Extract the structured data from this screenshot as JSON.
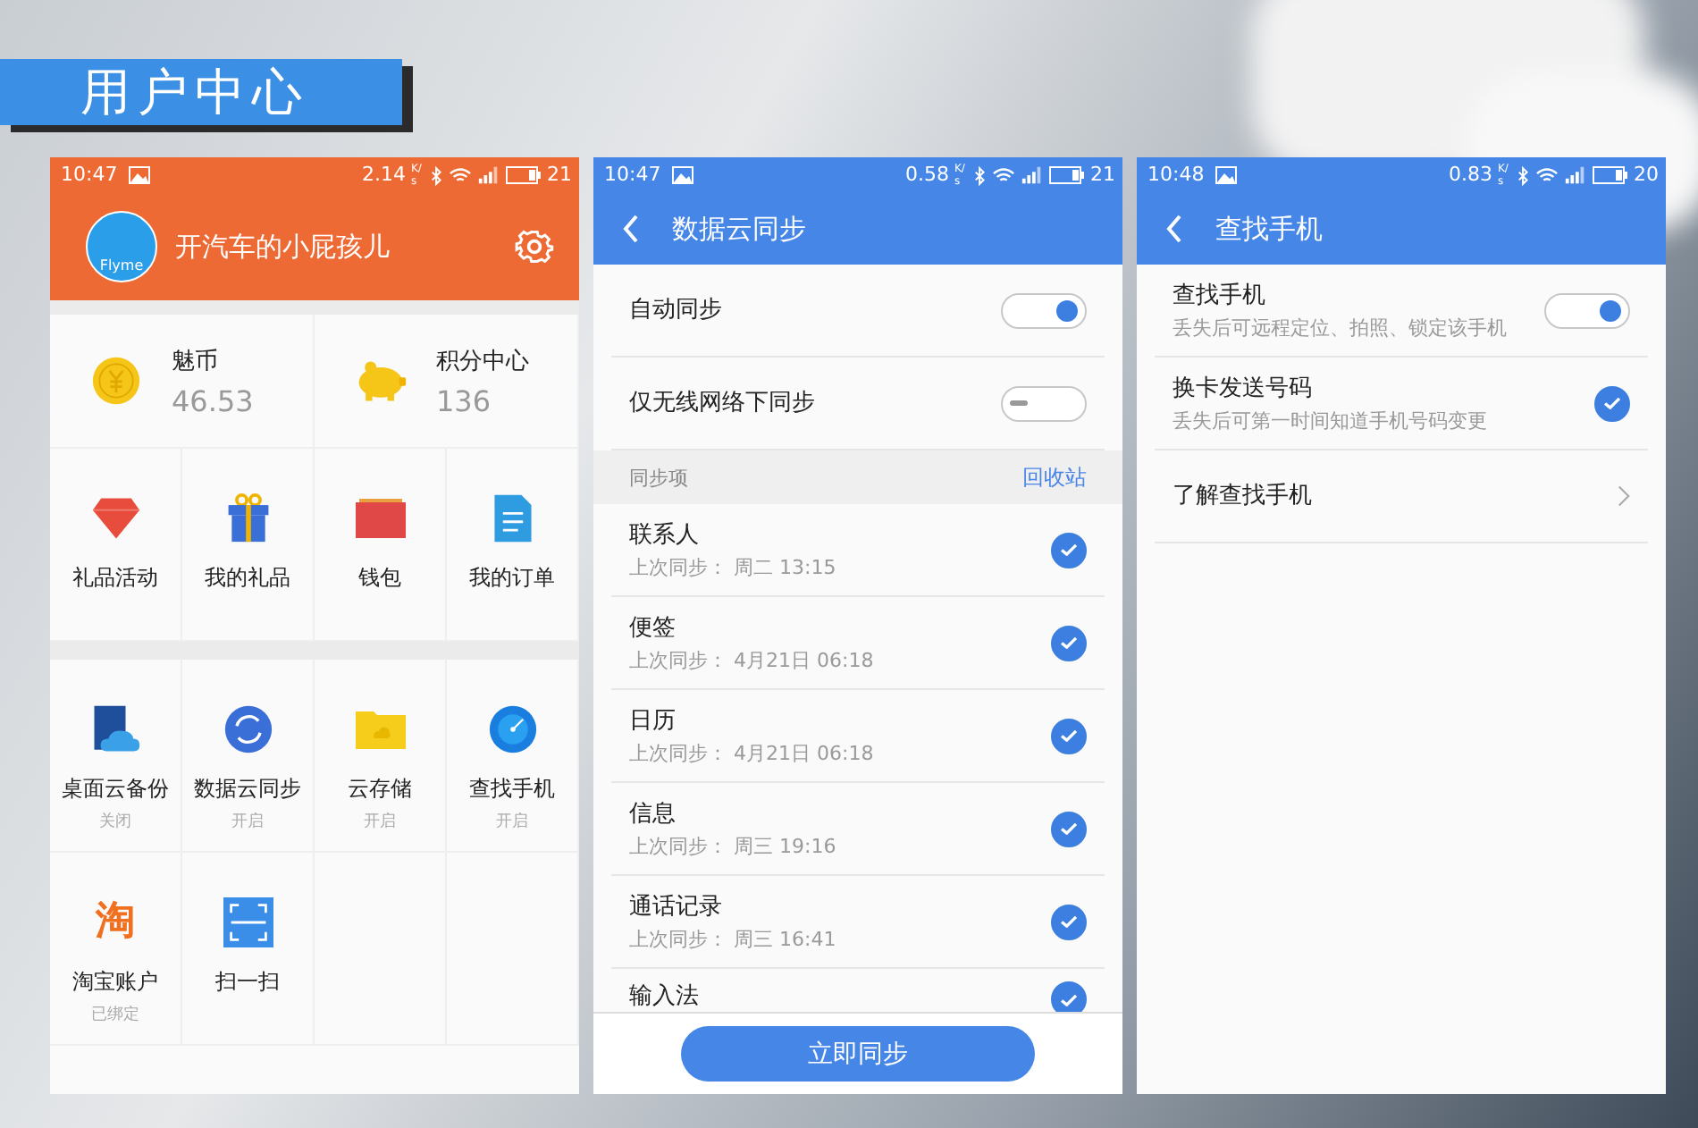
{
  "banner": {
    "title": "用户中心"
  },
  "account_screen": {
    "status_bar": {
      "time": "10:47",
      "rate": "2.14",
      "rate_unit": "K/s",
      "battery": "21"
    },
    "user": {
      "name": "开汽车的小屁孩儿",
      "avatar_text": "Flyme"
    },
    "wallet": [
      {
        "label": "魅币",
        "value": "46.53"
      },
      {
        "label": "积分中心",
        "value": "136"
      }
    ],
    "shortcuts": [
      {
        "label": "礼品活动"
      },
      {
        "label": "我的礼品"
      },
      {
        "label": "钱包"
      },
      {
        "label": "我的订单"
      }
    ],
    "services": [
      {
        "label": "桌面云备份",
        "status": "关闭"
      },
      {
        "label": "数据云同步",
        "status": "开启"
      },
      {
        "label": "云存储",
        "status": "开启"
      },
      {
        "label": "查找手机",
        "status": "开启"
      },
      {
        "label": "淘宝账户",
        "status": "已绑定",
        "icon_glyph": "淘"
      },
      {
        "label": "扫一扫"
      }
    ]
  },
  "sync_screen": {
    "status_bar": {
      "time": "10:47",
      "rate": "0.58",
      "rate_unit": "K/s",
      "battery": "21"
    },
    "title": "数据云同步",
    "settings": [
      {
        "label": "自动同步",
        "on": true
      },
      {
        "label": "仅无线网络下同步",
        "on": false
      }
    ],
    "section": {
      "label": "同步项",
      "link": "回收站"
    },
    "items": [
      {
        "name": "联系人",
        "last_sync": "上次同步： 周二 13:15",
        "checked": true
      },
      {
        "name": "便签",
        "last_sync": "上次同步： 4月21日 06:18",
        "checked": true
      },
      {
        "name": "日历",
        "last_sync": "上次同步： 4月21日 06:18",
        "checked": true
      },
      {
        "name": "信息",
        "last_sync": "上次同步： 周三 19:16",
        "checked": true
      },
      {
        "name": "通话记录",
        "last_sync": "上次同步： 周三 16:41",
        "checked": true
      },
      {
        "name": "输入法",
        "checked": true
      }
    ],
    "button": "立即同步"
  },
  "find_phone_screen": {
    "status_bar": {
      "time": "10:48",
      "rate": "0.83",
      "rate_unit": "K/s",
      "battery": "20"
    },
    "title": "查找手机",
    "rows": [
      {
        "kind": "toggle",
        "title": "查找手机",
        "subtitle": "丢失后可远程定位、拍照、锁定该手机",
        "on": true
      },
      {
        "kind": "check",
        "title": "换卡发送号码",
        "subtitle": "丢失后可第一时间知道手机号码变更",
        "checked": true
      },
      {
        "kind": "link",
        "title": "了解查找手机"
      }
    ]
  }
}
